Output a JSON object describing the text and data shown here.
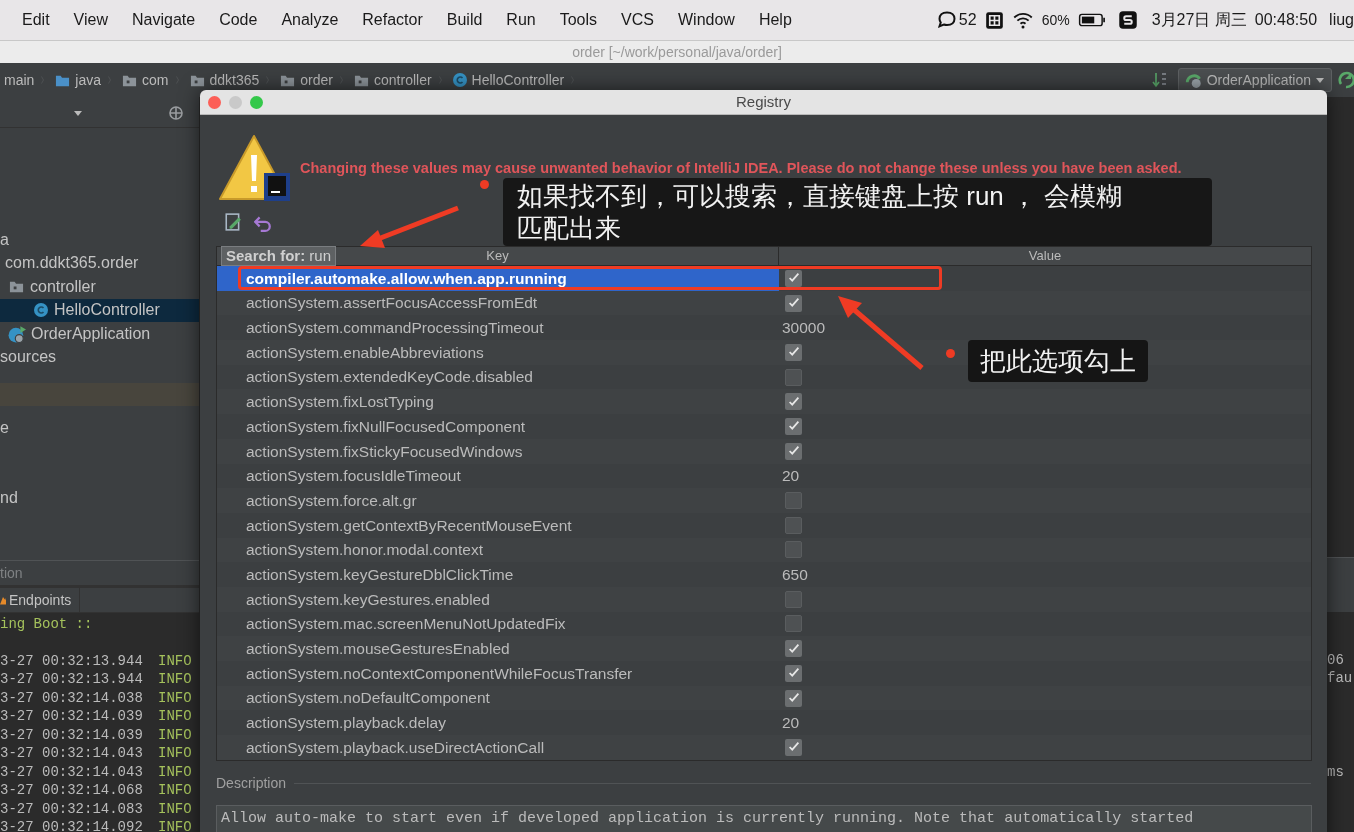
{
  "menu_bar": {
    "menus": [
      "Edit",
      "View",
      "Navigate",
      "Code",
      "Analyze",
      "Refactor",
      "Build",
      "Run",
      "Tools",
      "VCS",
      "Window",
      "Help"
    ],
    "status": {
      "notifications": "52",
      "battery": "60%",
      "date": "3月27日 周三",
      "time": "00:48:50",
      "user": "liug"
    }
  },
  "window": {
    "title": "order [~/work/personal/java/order]"
  },
  "breadcrumbs": [
    {
      "label": "main"
    },
    {
      "label": "java",
      "kind": "source-folder"
    },
    {
      "label": "com",
      "kind": "package"
    },
    {
      "label": "ddkt365",
      "kind": "package"
    },
    {
      "label": "order",
      "kind": "package"
    },
    {
      "label": "controller",
      "kind": "package"
    },
    {
      "label": "HelloController",
      "kind": "class"
    }
  ],
  "run_configuration": "OrderApplication",
  "project_tree": [
    {
      "label": "a",
      "selected": false,
      "children": [
        {
          "label": "com.ddkt365.order",
          "selected": false,
          "children": [
            {
              "label": "controller",
              "kind": "package",
              "selected": false,
              "children": [
                {
                  "label": "HelloController",
                  "kind": "class",
                  "selected": true
                }
              ]
            },
            {
              "label": "OrderApplication",
              "kind": "app",
              "selected": false
            }
          ]
        }
      ]
    },
    {
      "label": "sources",
      "selected": false
    }
  ],
  "project_tree_lower": [
    "e",
    "nd"
  ],
  "panel_header": "tion",
  "tool_tabs": [
    "Endpoints"
  ],
  "console": {
    "banner": "ing Boot ::",
    "lines": [
      {
        "time": "3-27 00:32:13.944",
        "level": "INFO"
      },
      {
        "time": "3-27 00:32:13.944",
        "level": "INFO"
      },
      {
        "time": "3-27 00:32:14.038",
        "level": "INFO"
      },
      {
        "time": "3-27 00:32:14.039",
        "level": "INFO"
      },
      {
        "time": "3-27 00:32:14.039",
        "level": "INFO"
      },
      {
        "time": "3-27 00:32:14.043",
        "level": "INFO"
      },
      {
        "time": "3-27 00:32:14.043",
        "level": "INFO"
      },
      {
        "time": "3-27 00:32:14.068",
        "level": "INFO"
      },
      {
        "time": "3-27 00:32:14.083",
        "level": "INFO"
      },
      {
        "time": "3-27 00:32:14.092",
        "level": "INFO"
      }
    ],
    "right_fragments": [
      "06",
      "fau",
      "ms"
    ]
  },
  "dialog": {
    "title": "Registry",
    "warning": "Changing these values may cause unwanted behavior of IntelliJ IDEA. Please do not change these unless you have been asked.",
    "search": "**Search for:** run",
    "columns": [
      "Key",
      "Value"
    ],
    "rows": [
      {
        "key": "compiler.automake.allow.when.app.running",
        "kind": "checkbox",
        "checked": true,
        "selected": true
      },
      {
        "key": "actionSystem.assertFocusAccessFromEdt",
        "kind": "checkbox",
        "checked": true,
        "selected": false
      },
      {
        "key": "actionSystem.commandProcessingTimeout",
        "kind": "text",
        "value": "30000",
        "selected": false
      },
      {
        "key": "actionSystem.enableAbbreviations",
        "kind": "checkbox",
        "checked": true,
        "selected": false
      },
      {
        "key": "actionSystem.extendedKeyCode.disabled",
        "kind": "checkbox",
        "checked": false,
        "selected": false
      },
      {
        "key": "actionSystem.fixLostTyping",
        "kind": "checkbox",
        "checked": true,
        "selected": false
      },
      {
        "key": "actionSystem.fixNullFocusedComponent",
        "kind": "checkbox",
        "checked": true,
        "selected": false
      },
      {
        "key": "actionSystem.fixStickyFocusedWindows",
        "kind": "checkbox",
        "checked": true,
        "selected": false
      },
      {
        "key": "actionSystem.focusIdleTimeout",
        "kind": "text",
        "value": "20",
        "selected": false
      },
      {
        "key": "actionSystem.force.alt.gr",
        "kind": "checkbox",
        "checked": false,
        "selected": false
      },
      {
        "key": "actionSystem.getContextByRecentMouseEvent",
        "kind": "checkbox",
        "checked": false,
        "selected": false
      },
      {
        "key": "actionSystem.honor.modal.context",
        "kind": "checkbox",
        "checked": false,
        "selected": false
      },
      {
        "key": "actionSystem.keyGestureDblClickTime",
        "kind": "text",
        "value": "650",
        "selected": false
      },
      {
        "key": "actionSystem.keyGestures.enabled",
        "kind": "checkbox",
        "checked": false,
        "selected": false
      },
      {
        "key": "actionSystem.mac.screenMenuNotUpdatedFix",
        "kind": "checkbox",
        "checked": false,
        "selected": false
      },
      {
        "key": "actionSystem.mouseGesturesEnabled",
        "kind": "checkbox",
        "checked": true,
        "selected": false
      },
      {
        "key": "actionSystem.noContextComponentWhileFocusTransfer",
        "kind": "checkbox",
        "checked": true,
        "selected": false
      },
      {
        "key": "actionSystem.noDefaultComponent",
        "kind": "checkbox",
        "checked": true,
        "selected": false
      },
      {
        "key": "actionSystem.playback.delay",
        "kind": "text",
        "value": "20",
        "selected": false
      },
      {
        "key": "actionSystem.playback.useDirectActionCall",
        "kind": "checkbox",
        "checked": true,
        "selected": false
      }
    ],
    "description_label": "Description",
    "description": "Allow auto-make to start even if developed application is currently running. Note that automatically started"
  },
  "annotations": [
    {
      "text": "如果找不到，可以搜索，直接键盘上按 run ， 会模糊匹配出来"
    },
    {
      "text": "把此选项勾上"
    }
  ]
}
